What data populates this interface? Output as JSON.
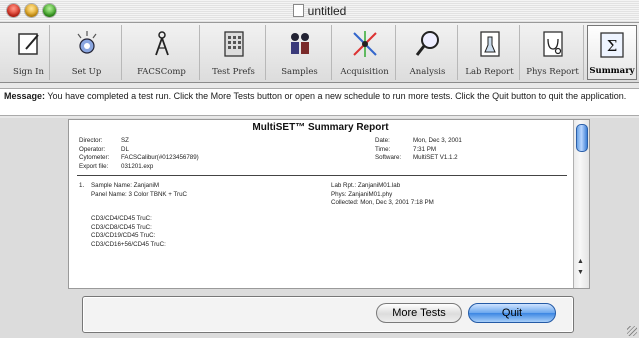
{
  "window": {
    "title": "untitled"
  },
  "toolbar": {
    "items": [
      {
        "label": "Sign In",
        "icon": "sign-in-icon"
      },
      {
        "label": "Set Up",
        "icon": "setup-icon"
      },
      {
        "label": "FACSComp",
        "icon": "facscomp-icon"
      },
      {
        "label": "Test Prefs",
        "icon": "test-prefs-icon"
      },
      {
        "label": "Samples",
        "icon": "samples-icon"
      },
      {
        "label": "Acquisition",
        "icon": "acquisition-icon"
      },
      {
        "label": "Analysis",
        "icon": "analysis-icon"
      },
      {
        "label": "Lab Report",
        "icon": "lab-report-icon"
      },
      {
        "label": "Phys Report",
        "icon": "phys-report-icon"
      },
      {
        "label": "Summary",
        "icon": "summary-icon"
      }
    ],
    "active": "Summary"
  },
  "message": {
    "label": "Message:",
    "text": "You have completed a test run.  Click the More Tests button or open a new schedule to run more tests.  Click the Quit button to quit the application."
  },
  "report": {
    "title": "MultiSET™ Summary Report",
    "left_fields": [
      {
        "key": "Director:",
        "value": "SZ"
      },
      {
        "key": "Operator:",
        "value": "DL"
      },
      {
        "key": "Cytometer:",
        "value": "FACSCalibur(#0123456789)"
      },
      {
        "key": "Export file:",
        "value": "031201.exp"
      }
    ],
    "right_fields": [
      {
        "key": "Date:",
        "value": "Mon, Dec 3, 2001"
      },
      {
        "key": "Time:",
        "value": "7:31 PM"
      },
      {
        "key": "Software:",
        "value": "MultiSET V1.1.2"
      }
    ],
    "sample": {
      "number": "1.",
      "name_line": "Sample Name: ZanjaniM",
      "panel_line": "Panel Name:   3 Color TBNK + TruC",
      "lab_rpt": "Lab Rpt.:  ZanjaniM01.lab",
      "phys": "Phys:       ZanjaniM01.phy",
      "collected": "Collected: Mon, Dec 3, 2001 7:18 PM",
      "tubes": [
        "CD3/CD4/CD45 TruC:",
        "CD3/CD8/CD45 TruC:",
        "CD3/CD19/CD45 TruC:",
        "CD3/CD16+56/CD45 TruC:"
      ]
    }
  },
  "buttons": {
    "more_tests": "More Tests",
    "quit": "Quit"
  },
  "colors": {
    "accent": "#3b86e3",
    "toolbar_bg": "#e6e6e6"
  }
}
